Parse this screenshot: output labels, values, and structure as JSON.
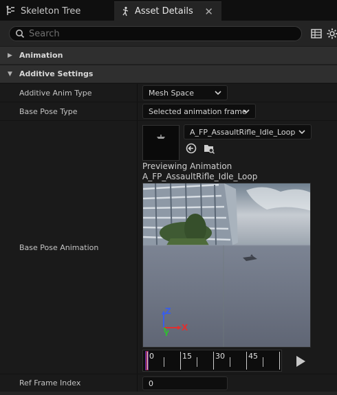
{
  "tabs": [
    {
      "label": "Skeleton Tree",
      "active": false
    },
    {
      "label": "Asset Details",
      "active": true
    }
  ],
  "close_glyph": "✕",
  "search": {
    "placeholder": "Search",
    "value": ""
  },
  "toolbar_icons": [
    "table-view-icon",
    "settings-gear-icon"
  ],
  "categories": {
    "animation": {
      "label": "Animation",
      "expanded": false
    },
    "additive": {
      "label": "Additive Settings",
      "expanded": true
    }
  },
  "properties": {
    "additive_anim_type": {
      "label": "Additive Anim Type",
      "value": "Mesh Space"
    },
    "base_pose_type": {
      "label": "Base Pose Type",
      "value": "Selected animation frame"
    },
    "base_pose_animation": {
      "label": "Base Pose Animation",
      "value": "A_FP_AssaultRifle_Idle_Loop",
      "preview_line1": "Previewing Animation",
      "preview_line2": "A_FP_AssaultRifle_Idle_Loop"
    },
    "ref_frame_index": {
      "label": "Ref Frame Index",
      "value": "0"
    }
  },
  "viewport_axes": {
    "z": "Z",
    "y": "Y",
    "x": "X"
  },
  "timeline": {
    "ticks": [
      "0",
      "15",
      "30",
      "45"
    ]
  },
  "colors": {
    "background": "#242424",
    "axis_x": "#e03030",
    "axis_y": "#2fbf2f",
    "axis_z": "#3a5ee8",
    "playhead": "#c8323c"
  }
}
